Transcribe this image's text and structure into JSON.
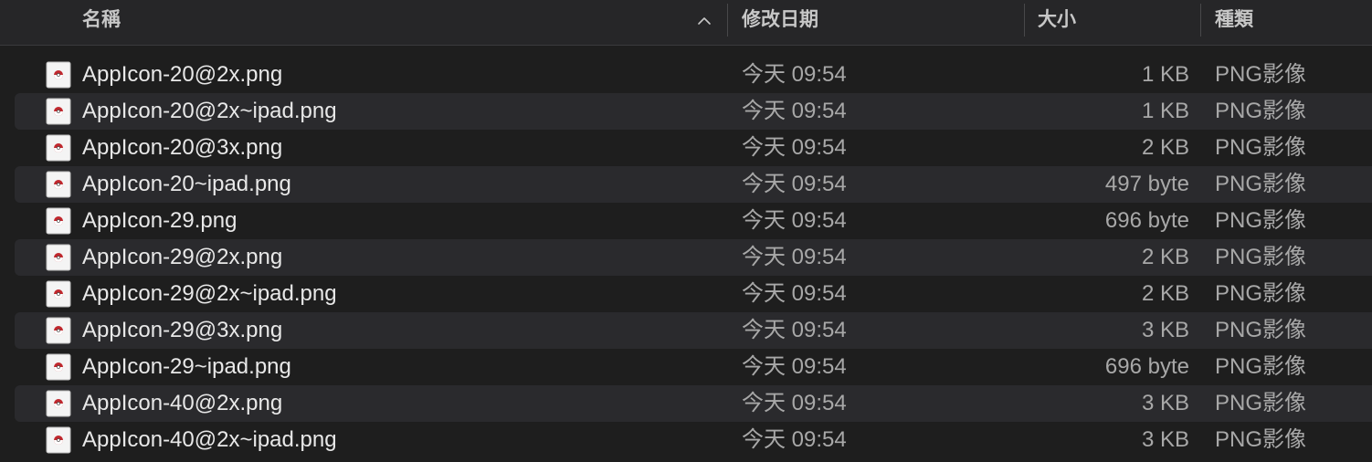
{
  "columns": {
    "name": "名稱",
    "date": "修改日期",
    "size": "大小",
    "kind": "種類"
  },
  "files": [
    {
      "name": "AppIcon-20@2x.png",
      "date": "今天 09:54",
      "size": "1 KB",
      "kind": "PNG影像"
    },
    {
      "name": "AppIcon-20@2x~ipad.png",
      "date": "今天 09:54",
      "size": "1 KB",
      "kind": "PNG影像"
    },
    {
      "name": "AppIcon-20@3x.png",
      "date": "今天 09:54",
      "size": "2 KB",
      "kind": "PNG影像"
    },
    {
      "name": "AppIcon-20~ipad.png",
      "date": "今天 09:54",
      "size": "497 byte",
      "kind": "PNG影像"
    },
    {
      "name": "AppIcon-29.png",
      "date": "今天 09:54",
      "size": "696 byte",
      "kind": "PNG影像"
    },
    {
      "name": "AppIcon-29@2x.png",
      "date": "今天 09:54",
      "size": "2 KB",
      "kind": "PNG影像"
    },
    {
      "name": "AppIcon-29@2x~ipad.png",
      "date": "今天 09:54",
      "size": "2 KB",
      "kind": "PNG影像"
    },
    {
      "name": "AppIcon-29@3x.png",
      "date": "今天 09:54",
      "size": "3 KB",
      "kind": "PNG影像"
    },
    {
      "name": "AppIcon-29~ipad.png",
      "date": "今天 09:54",
      "size": "696 byte",
      "kind": "PNG影像"
    },
    {
      "name": "AppIcon-40@2x.png",
      "date": "今天 09:54",
      "size": "3 KB",
      "kind": "PNG影像"
    },
    {
      "name": "AppIcon-40@2x~ipad.png",
      "date": "今天 09:54",
      "size": "3 KB",
      "kind": "PNG影像"
    }
  ],
  "icons": {
    "sort": "chevron-up-icon",
    "file": "png-file-icon"
  },
  "colors": {
    "background": "#1e1e1e",
    "header": "#262628",
    "row_alt": "#2a2a2d",
    "text": "#e8e8e8",
    "text_secondary": "#a8a8a8",
    "icon_red": "#c0282e"
  }
}
